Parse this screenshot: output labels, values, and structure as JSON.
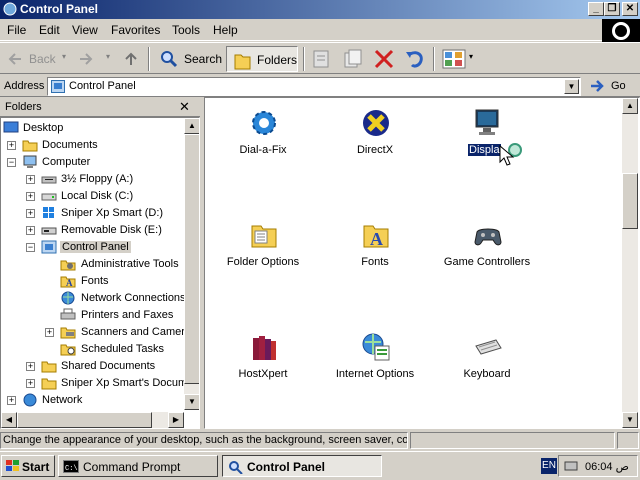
{
  "window": {
    "title": "Control Panel",
    "buttons": [
      "minimize",
      "restore",
      "close"
    ]
  },
  "menu": [
    "File",
    "Edit",
    "View",
    "Favorites",
    "Tools",
    "Help"
  ],
  "toolbar": {
    "back": "Back",
    "search": "Search",
    "folders": "Folders"
  },
  "address": {
    "label": "Address",
    "value": "Control Panel",
    "go": "Go"
  },
  "folders_pane": {
    "title": "Folders",
    "tree": [
      {
        "label": "Desktop"
      },
      {
        "label": "Documents"
      },
      {
        "label": "Computer"
      },
      {
        "label": "3½ Floppy (A:)"
      },
      {
        "label": "Local Disk (C:)"
      },
      {
        "label": "Sniper Xp Smart (D:)"
      },
      {
        "label": "Removable Disk (E:)"
      },
      {
        "label": "Control Panel"
      },
      {
        "label": "Administrative Tools"
      },
      {
        "label": "Fonts"
      },
      {
        "label": "Network Connections"
      },
      {
        "label": "Printers and Faxes"
      },
      {
        "label": "Scanners and Camera"
      },
      {
        "label": "Scheduled Tasks"
      },
      {
        "label": "Shared Documents"
      },
      {
        "label": "Sniper Xp Smart's Docume"
      },
      {
        "label": "Network"
      }
    ]
  },
  "items": [
    {
      "label": "Dial-a-Fix",
      "icon": "gear-icon"
    },
    {
      "label": "DirectX",
      "icon": "directx-icon"
    },
    {
      "label": "Displa",
      "icon": "display-icon"
    },
    {
      "label": "Folder Options",
      "icon": "folder-options-icon"
    },
    {
      "label": "Fonts",
      "icon": "fonts-folder-icon"
    },
    {
      "label": "Game Controllers",
      "icon": "gamepad-icon"
    },
    {
      "label": "HostXpert",
      "icon": "books-icon"
    },
    {
      "label": "Internet Options",
      "icon": "globe-icon"
    },
    {
      "label": "Keyboard",
      "icon": "keyboard-icon"
    }
  ],
  "status": {
    "text": "Change the appearance of your desktop, such as the background, screen saver, col"
  },
  "taskbar": {
    "start": "Start",
    "tasks": [
      "Command Prompt",
      "Control Panel"
    ],
    "lang": "EN",
    "clock": "06:04 ص"
  }
}
